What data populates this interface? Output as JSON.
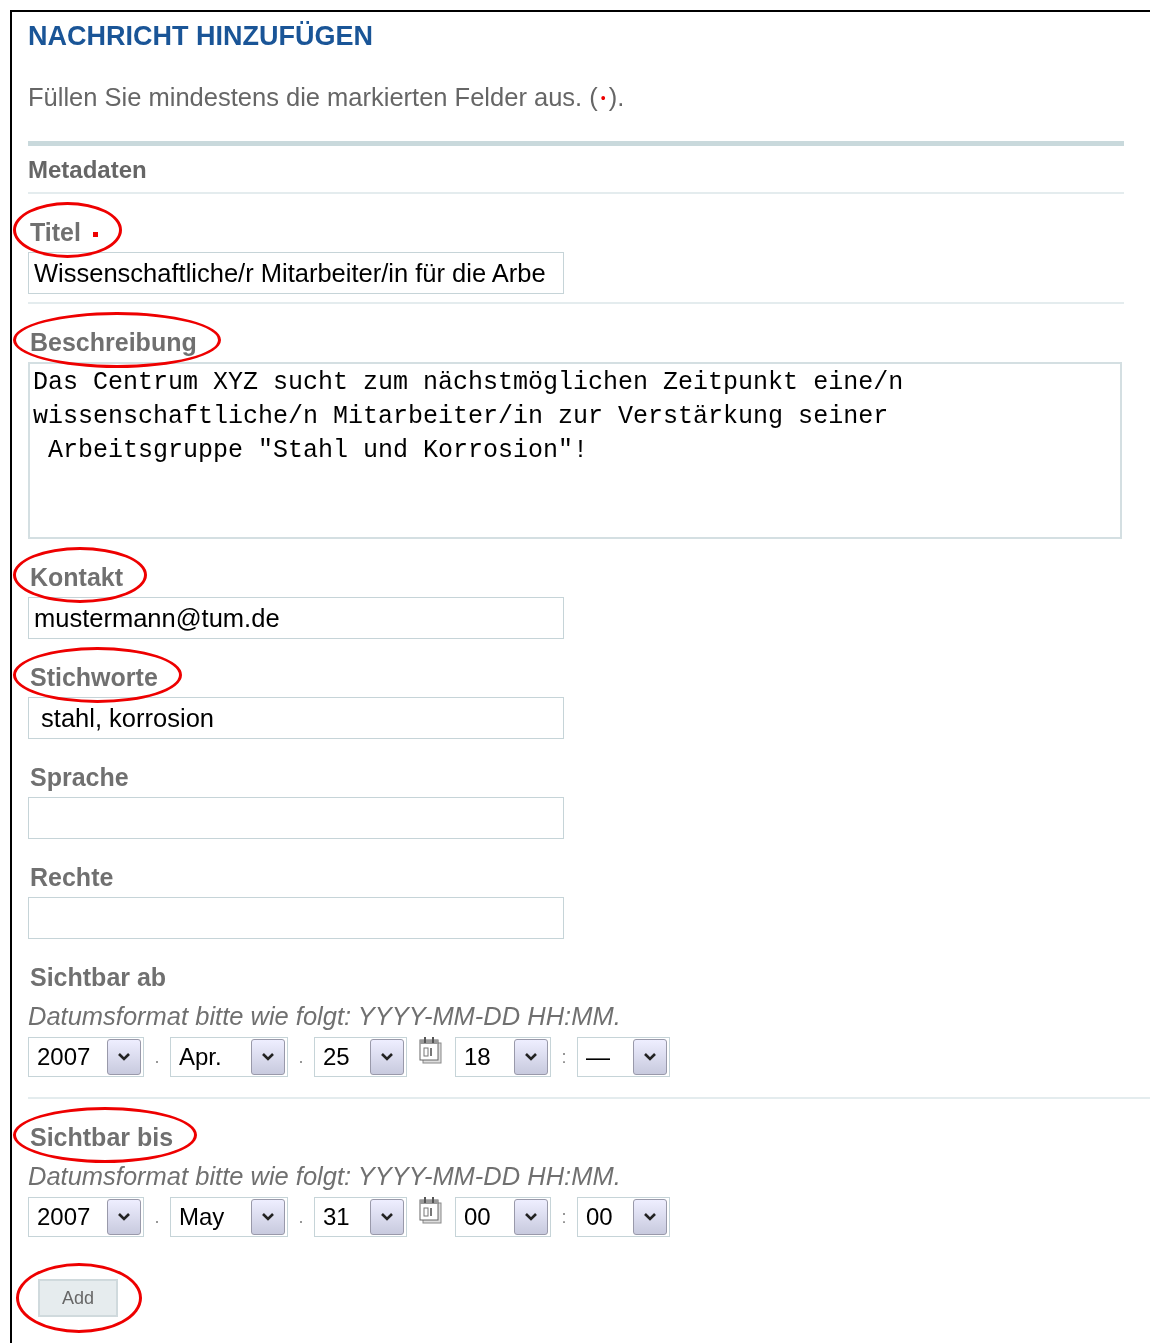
{
  "title": "NACHRICHT HINZUFÜGEN",
  "instruction": {
    "text": "Füllen Sie mindestens die markierten Felder aus. (",
    "mark": "•",
    "after": ")."
  },
  "section": "Metadaten",
  "fields": [
    {
      "kind": "text",
      "label": "Titel",
      "required": true,
      "highlighted": true,
      "divider_after": true,
      "value": "Wissenschaftliche/r Mitarbeiter/in für die Arbe"
    },
    {
      "kind": "textarea",
      "label": "Beschreibung",
      "required": false,
      "highlighted": true,
      "divider_after": false,
      "value": "Das Centrum XYZ sucht zum nächstmöglichen Zeitpunkt eine/n\nwissenschaftliche/n Mitarbeiter/in zur Verstärkung seiner\n Arbeitsgruppe \"Stahl und Korrosion\"!"
    },
    {
      "kind": "text",
      "label": "Kontakt",
      "required": false,
      "highlighted": true,
      "divider_after": false,
      "value": "mustermann@tum.de"
    },
    {
      "kind": "text",
      "label": "Stichworte",
      "required": false,
      "highlighted": true,
      "divider_after": false,
      "value": " stahl, korrosion"
    },
    {
      "kind": "text",
      "label": "Sprache",
      "required": false,
      "highlighted": false,
      "divider_after": false
    },
    {
      "kind": "text",
      "label": "Rechte",
      "required": false,
      "highlighted": false,
      "divider_after": false
    },
    {
      "kind": "datetime",
      "label": "Sichtbar ab",
      "required": false,
      "highlighted": false,
      "divider_after": true,
      "hint": "Datumsformat bitte wie folgt: YYYY-MM-DD HH:MM.",
      "parts": [
        {
          "kind": "select",
          "value": "2007"
        },
        {
          "kind": "separator",
          "text": "."
        },
        {
          "kind": "select",
          "value": "Apr."
        },
        {
          "kind": "separator",
          "text": "."
        },
        {
          "kind": "select",
          "value": "25"
        },
        {
          "kind": "calendar"
        },
        {
          "kind": "select",
          "value": "18"
        },
        {
          "kind": "separator",
          "text": ":"
        },
        {
          "kind": "select",
          "value": "—"
        }
      ]
    },
    {
      "kind": "datetime",
      "label": "Sichtbar bis",
      "required": false,
      "highlighted": true,
      "divider_after": false,
      "hint": "Datumsformat bitte wie folgt: YYYY-MM-DD HH:MM.",
      "parts": [
        {
          "kind": "select",
          "value": "2007"
        },
        {
          "kind": "separator",
          "text": "."
        },
        {
          "kind": "select",
          "value": "May"
        },
        {
          "kind": "separator",
          "text": "."
        },
        {
          "kind": "select",
          "value": "31"
        },
        {
          "kind": "calendar"
        },
        {
          "kind": "select",
          "value": "00"
        },
        {
          "kind": "separator",
          "text": ":"
        },
        {
          "kind": "select",
          "value": "00"
        }
      ]
    }
  ],
  "submit": {
    "label": "Add",
    "highlighted": true
  }
}
